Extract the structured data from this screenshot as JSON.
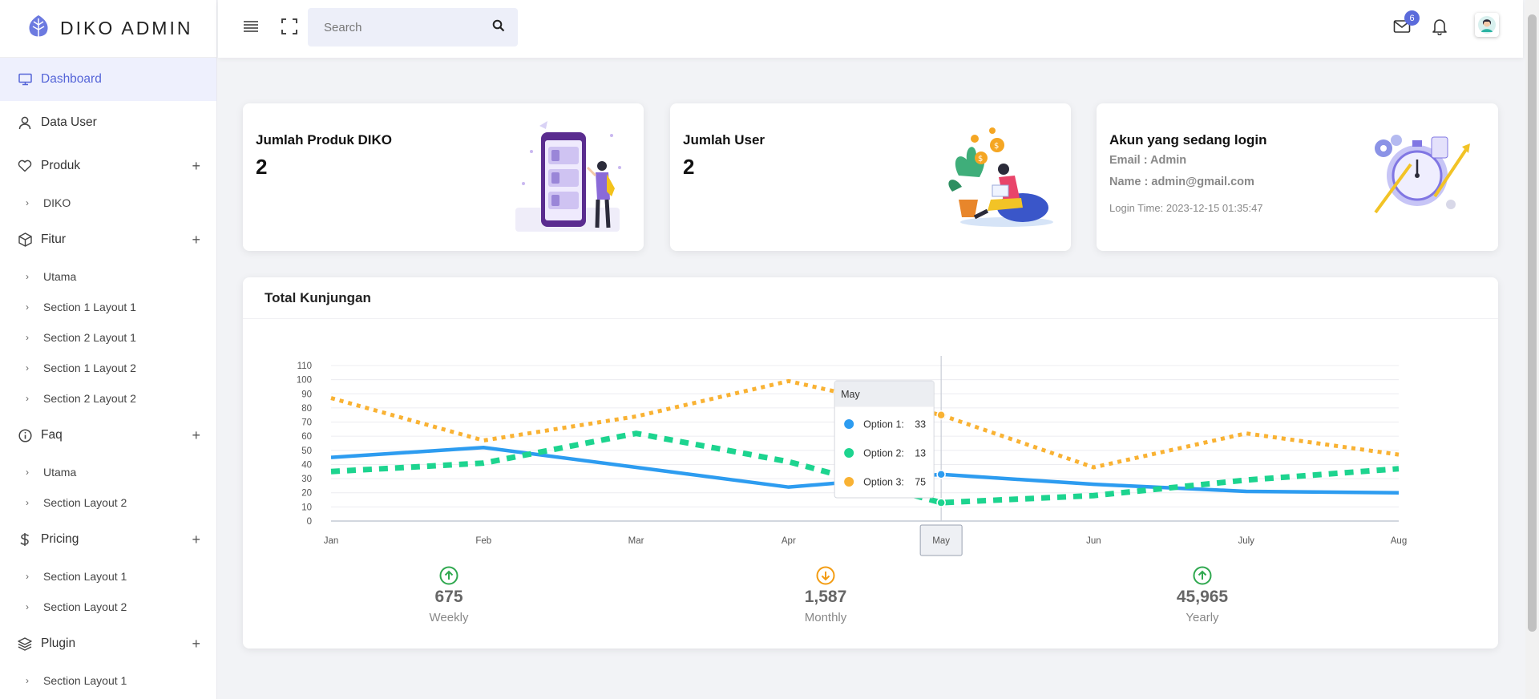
{
  "brand": {
    "name": "DIKO ADMIN"
  },
  "sidebar": {
    "items": [
      {
        "label": "Dashboard",
        "icon": "monitor-icon",
        "active": true,
        "expandable": false,
        "children": []
      },
      {
        "label": "Data User",
        "icon": "user-icon",
        "active": false,
        "expandable": false,
        "children": []
      },
      {
        "label": "Produk",
        "icon": "heart-icon",
        "active": false,
        "expandable": true,
        "children": [
          "DIKO"
        ]
      },
      {
        "label": "Fitur",
        "icon": "box-icon",
        "active": false,
        "expandable": true,
        "children": [
          "Utama",
          "Section 1 Layout 1",
          "Section 2 Layout 1",
          "Section 1 Layout 2",
          "Section 2 Layout 2"
        ]
      },
      {
        "label": "Faq",
        "icon": "info-icon",
        "active": false,
        "expandable": true,
        "children": [
          "Utama",
          "Section Layout 2"
        ]
      },
      {
        "label": "Pricing",
        "icon": "dollar-icon",
        "active": false,
        "expandable": true,
        "children": [
          "Section Layout 1",
          "Section Layout 2"
        ]
      },
      {
        "label": "Plugin",
        "icon": "layers-icon",
        "active": false,
        "expandable": true,
        "children": [
          "Section Layout 1"
        ]
      }
    ],
    "plus_symbol": "+",
    "chevron_symbol": "›"
  },
  "header": {
    "search": {
      "placeholder": "Search"
    },
    "mail_badge": "6"
  },
  "cards": {
    "produk": {
      "title": "Jumlah Produk DIKO",
      "value": "2"
    },
    "user": {
      "title": "Jumlah User",
      "value": "2"
    },
    "login": {
      "title": "Akun yang sedang login",
      "email": "Email : Admin",
      "name": "Name : admin@gmail.com",
      "time": "Login Time: 2023-12-15 01:35:47"
    }
  },
  "chart_data": {
    "type": "line",
    "title": "Total Kunjungan",
    "categories": [
      "Jan",
      "Feb",
      "Mar",
      "Apr",
      "May",
      "Jun",
      "July",
      "Aug"
    ],
    "series": [
      {
        "name": "Option 1",
        "values": [
          45,
          52,
          38,
          24,
          33,
          26,
          21,
          20
        ],
        "color": "#2d9cf0",
        "dash": "solid"
      },
      {
        "name": "Option 2",
        "values": [
          35,
          41,
          62,
          42,
          13,
          18,
          29,
          37
        ],
        "color": "#1dd48f",
        "dash": "dashed"
      },
      {
        "name": "Option 3",
        "values": [
          87,
          57,
          74,
          99,
          75,
          38,
          62,
          47
        ],
        "color": "#f9b233",
        "dash": "dotted"
      }
    ],
    "y_ticks": [
      "0",
      "10",
      "20",
      "30",
      "40",
      "50",
      "60",
      "70",
      "80",
      "90",
      "100",
      "110"
    ],
    "ylim": [
      0,
      110
    ],
    "grid": true,
    "tooltip": {
      "category": "May",
      "rows": [
        {
          "label": "Option 1:",
          "value": "33",
          "color": "#2d9cf0"
        },
        {
          "label": "Option 2:",
          "value": "13",
          "color": "#1dd48f"
        },
        {
          "label": "Option 3:",
          "value": "75",
          "color": "#f9b233"
        }
      ]
    },
    "summary": [
      {
        "value": "675",
        "label": "Weekly",
        "trend": "up",
        "color": "#2fa84f"
      },
      {
        "value": "1,587",
        "label": "Monthly",
        "trend": "down",
        "color": "#f39c12"
      },
      {
        "value": "45,965",
        "label": "Yearly",
        "trend": "up",
        "color": "#2fa84f"
      }
    ]
  }
}
